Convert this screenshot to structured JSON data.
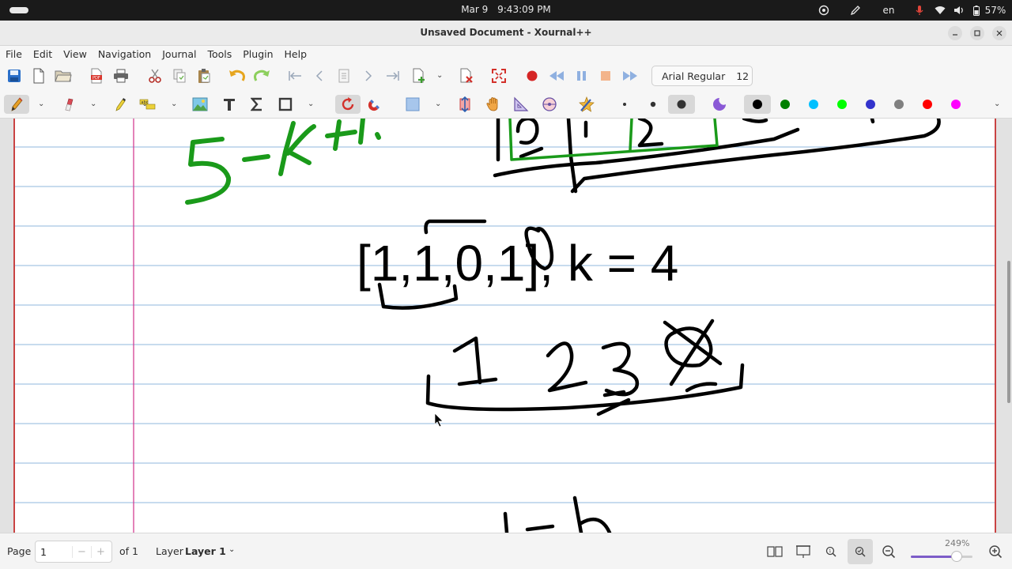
{
  "system_bar": {
    "date": "Mar 9",
    "time": "9:43:09 PM",
    "language": "en",
    "battery": "57%"
  },
  "window": {
    "title": "Unsaved Document - Xournal++"
  },
  "menu": [
    "File",
    "Edit",
    "View",
    "Navigation",
    "Journal",
    "Tools",
    "Plugin",
    "Help"
  ],
  "toolbar": {
    "font_name": "Arial Regular",
    "font_size": "12"
  },
  "palette": [
    "#000000",
    "#008000",
    "#00c0ff",
    "#00ff00",
    "#3333cc",
    "#808080",
    "#ff0000",
    "#ff00ff"
  ],
  "canvas": {
    "typed_text": "[1,1,0,1], k = 4",
    "page_background": "ruled",
    "ruling_color": "#8fb7dd",
    "margin_color": "#d0308a"
  },
  "statusbar": {
    "page_label": "Page",
    "page_value": "1",
    "of_label": "of 1",
    "layer_label": "Layer",
    "layer_value": "Layer 1",
    "zoom": "249%",
    "zoom_fraction": 0.74
  },
  "colors": {
    "accent": "#7c5cc8",
    "ink_black": "#000000",
    "ink_green": "#1a9a1a"
  }
}
